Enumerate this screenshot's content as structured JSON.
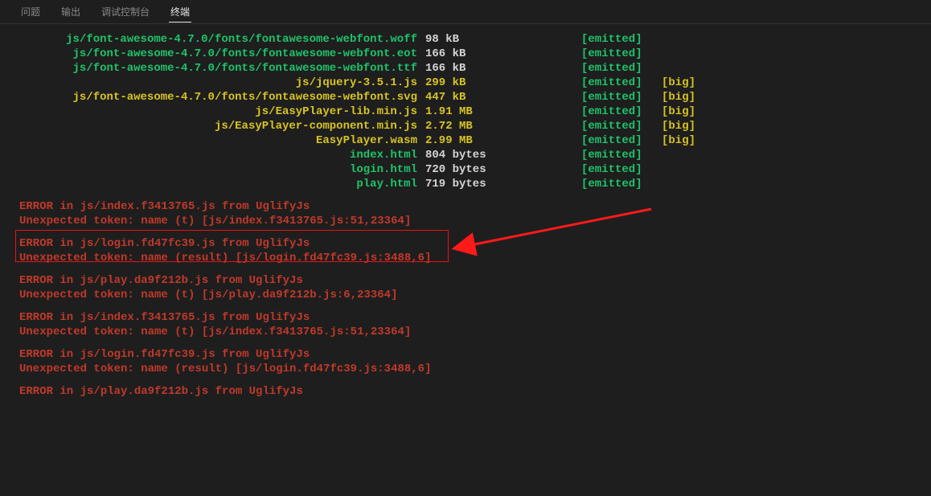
{
  "tabs": {
    "problems": "问题",
    "output": "输出",
    "debug": "调试控制台",
    "terminal": "终端"
  },
  "rows": [
    {
      "asset": "js/font-awesome-4.7.0/fonts/fontawesome-webfont.woff",
      "size": "98 kB",
      "big": "",
      "c": "green"
    },
    {
      "asset": "js/font-awesome-4.7.0/fonts/fontawesome-webfont.eot",
      "size": "166 kB",
      "big": "",
      "c": "green"
    },
    {
      "asset": "js/font-awesome-4.7.0/fonts/fontawesome-webfont.ttf",
      "size": "166 kB",
      "big": "",
      "c": "green"
    },
    {
      "asset": "js/jquery-3.5.1.js",
      "size": "299 kB",
      "big": "[big]",
      "c": "yellow"
    },
    {
      "asset": "js/font-awesome-4.7.0/fonts/fontawesome-webfont.svg",
      "size": "447 kB",
      "big": "[big]",
      "c": "yellow"
    },
    {
      "asset": "js/EasyPlayer-lib.min.js",
      "size": "1.91 MB",
      "big": "[big]",
      "c": "yellow"
    },
    {
      "asset": "js/EasyPlayer-component.min.js",
      "size": "2.72 MB",
      "big": "[big]",
      "c": "yellow"
    },
    {
      "asset": "EasyPlayer.wasm",
      "size": "2.99 MB",
      "big": "[big]",
      "c": "yellow"
    },
    {
      "asset": "index.html",
      "size": "804 bytes",
      "big": "",
      "c": "green"
    },
    {
      "asset": "login.html",
      "size": "720 bytes",
      "big": "",
      "c": "green"
    },
    {
      "asset": "play.html",
      "size": "719 bytes",
      "big": "",
      "c": "green"
    }
  ],
  "emitted": "[emitted]",
  "errors": [
    {
      "l1": "ERROR in js/index.f3413765.js from UglifyJs",
      "l2": "Unexpected token: name (t) [js/index.f3413765.js:51,23364]"
    },
    {
      "l1": "ERROR in js/login.fd47fc39.js from UglifyJs",
      "l2": "Unexpected token: name (result) [js/login.fd47fc39.js:3488,6]"
    },
    {
      "l1": "ERROR in js/play.da9f212b.js from UglifyJs",
      "l2": "Unexpected token: name (t) [js/play.da9f212b.js:6,23364]"
    },
    {
      "l1": "ERROR in js/index.f3413765.js from UglifyJs",
      "l2": "Unexpected token: name (t) [js/index.f3413765.js:51,23364]"
    },
    {
      "l1": "ERROR in js/login.fd47fc39.js from UglifyJs",
      "l2": "Unexpected token: name (result) [js/login.fd47fc39.js:3488,6]"
    },
    {
      "l1": "ERROR in js/play.da9f212b.js from UglifyJs",
      "l2": ""
    }
  ]
}
